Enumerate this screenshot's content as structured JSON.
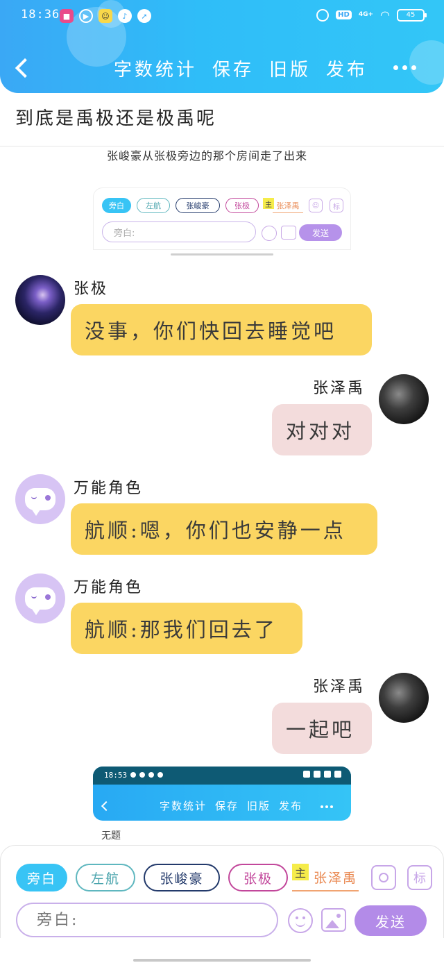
{
  "status_bar": {
    "time": "18:36",
    "hd": "HD",
    "network": "4G+",
    "battery": "45"
  },
  "nav": {
    "actions": [
      {
        "label": "字数统计"
      },
      {
        "label": "保存"
      },
      {
        "label": "旧版"
      },
      {
        "label": "发布"
      }
    ]
  },
  "document": {
    "title": "到底是禹极还是极禹呢"
  },
  "embed_top": {
    "text": "张峻豪从张极旁边的那个房间走了出来",
    "chips": [
      "旁白",
      "左航",
      "张峻豪",
      "张极",
      "张泽禹"
    ],
    "main_badge": "主",
    "tag_label": "标",
    "input_placeholder": "旁白:",
    "send_label": "发送"
  },
  "messages": [
    {
      "side": "left",
      "speaker": "张极",
      "text": "没事，你们快回去睡觉吧",
      "avatar": "photo"
    },
    {
      "side": "right",
      "speaker": "张泽禹",
      "text": "对对对",
      "avatar": "photo"
    },
    {
      "side": "left",
      "speaker": "万能角色",
      "text": "航顺:嗯，你们也安静一点",
      "avatar": "omni-character"
    },
    {
      "side": "left",
      "speaker": "万能角色",
      "text": "航顺:那我们回去了",
      "avatar": "omni-character"
    },
    {
      "side": "right",
      "speaker": "张泽禹",
      "text": "一起吧",
      "avatar": "photo"
    }
  ],
  "embed_bottom": {
    "time": "18:53",
    "actions": [
      "字数统计",
      "保存",
      "旧版",
      "发布"
    ],
    "caption": "无题"
  },
  "composer": {
    "chips": [
      {
        "label": "旁白",
        "selected": true
      },
      {
        "label": "左航",
        "selected": false
      },
      {
        "label": "张峻豪",
        "selected": false
      },
      {
        "label": "张极",
        "selected": false
      },
      {
        "label": "张泽禹",
        "selected": false
      }
    ],
    "main_badge": "主",
    "tag_label": "标",
    "input_placeholder": "旁白:",
    "send_label": "发送"
  },
  "colors": {
    "header_blue": "#33b6f6",
    "left_bubble": "#fbd662",
    "right_bubble": "#f3dcdc",
    "accent_purple": "#b38be8"
  }
}
